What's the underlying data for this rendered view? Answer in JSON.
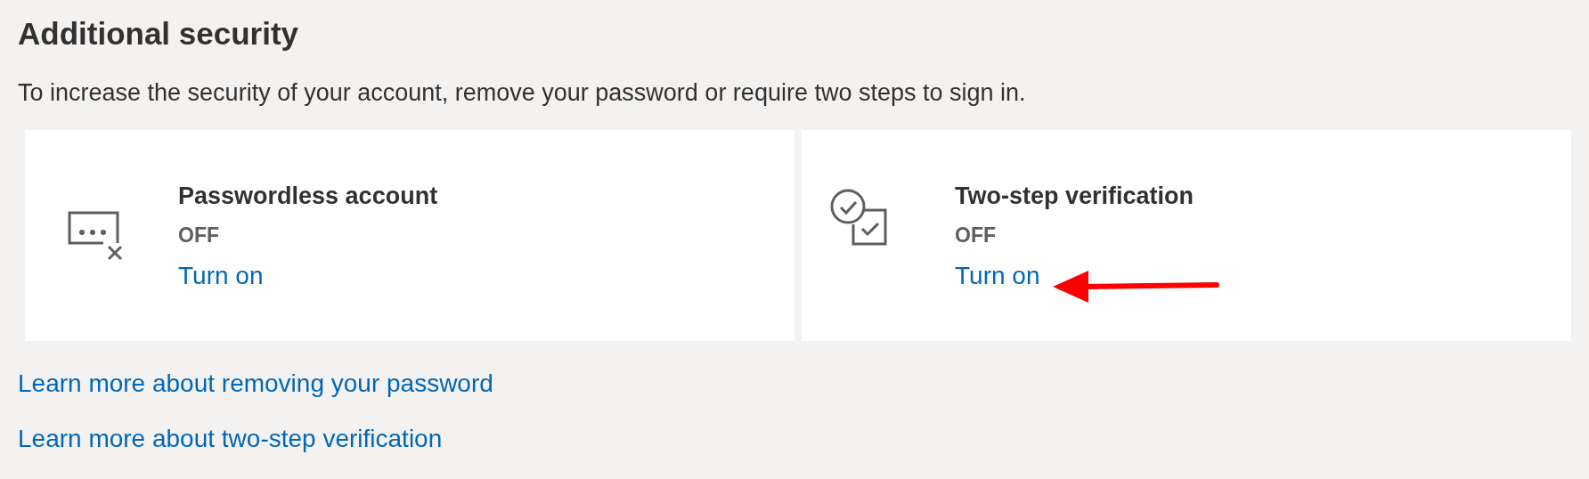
{
  "heading": "Additional security",
  "description": "To increase the security of your account, remove your password or require two steps to sign in.",
  "cards": [
    {
      "kind": "password",
      "title": "Passwordless account",
      "status": "OFF",
      "action": "Turn on",
      "pointed_at": false
    },
    {
      "kind": "twostep",
      "title": "Two-step verification",
      "status": "OFF",
      "action": "Turn on",
      "pointed_at": true
    }
  ],
  "links": [
    "Learn more about removing your password",
    "Learn more about two-step verification"
  ]
}
